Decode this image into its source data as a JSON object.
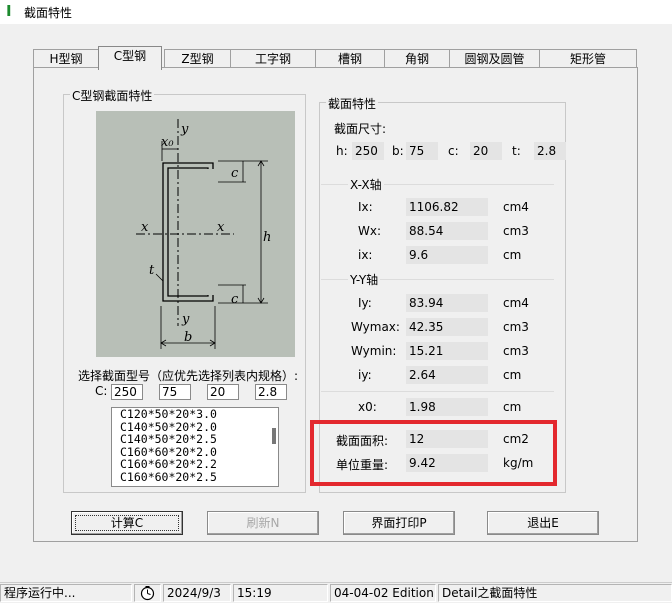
{
  "window": {
    "title": "截面特性",
    "icon": "app-icon-green-I"
  },
  "tabs": [
    {
      "label": "H型钢",
      "active": false
    },
    {
      "label": "C型钢",
      "active": true
    },
    {
      "label": "Z型钢",
      "active": false
    },
    {
      "label": "工字钢",
      "active": false
    },
    {
      "label": "槽钢",
      "active": false
    },
    {
      "label": "角钢",
      "active": false
    },
    {
      "label": "圆钢及圆管",
      "active": false
    },
    {
      "label": "矩形管",
      "active": false
    }
  ],
  "left_group": {
    "title": "C型钢截面特性",
    "diagram_labels": {
      "x0": "x₀",
      "y": "y",
      "x": "x",
      "c": "c",
      "h": "h",
      "t": "t",
      "b": "b"
    },
    "select_prompt": "选择截面型号（应优先选择列表内规格）:",
    "c_label": "C:",
    "inputs": [
      "250",
      "75",
      "20",
      "2.8"
    ],
    "list": [
      "C120*50*20*3.0",
      "C140*50*20*2.0",
      "C140*50*20*2.5",
      "C160*60*20*2.0",
      "C160*60*20*2.2",
      "C160*60*20*2.5"
    ]
  },
  "right_group": {
    "title": "截面特性",
    "size_label": "截面尺寸:",
    "dims": [
      {
        "label": "h:",
        "value": "250"
      },
      {
        "label": "b:",
        "value": "75"
      },
      {
        "label": "c:",
        "value": "20"
      },
      {
        "label": "t:",
        "value": "2.8"
      }
    ],
    "xx_title": "X-X轴",
    "xx": [
      {
        "label": "Ix:",
        "value": "1106.82",
        "unit": "cm4"
      },
      {
        "label": "Wx:",
        "value": "88.54",
        "unit": "cm3"
      },
      {
        "label": "ix:",
        "value": "9.6",
        "unit": "cm"
      }
    ],
    "yy_title": "Y-Y轴",
    "yy": [
      {
        "label": "Iy:",
        "value": "83.94",
        "unit": "cm4"
      },
      {
        "label": "Wymax:",
        "value": "42.35",
        "unit": "cm3"
      },
      {
        "label": "Wymin:",
        "value": "15.21",
        "unit": "cm3"
      },
      {
        "label": "iy:",
        "value": "2.64",
        "unit": "cm"
      }
    ],
    "x0": {
      "label": "x0:",
      "value": "1.98",
      "unit": "cm"
    },
    "area": {
      "label": "截面面积:",
      "value": "12",
      "unit": "cm2"
    },
    "weight": {
      "label": "单位重量:",
      "value": "9.42",
      "unit": "kg/m"
    },
    "highlight_color": "#e3282e"
  },
  "buttons": {
    "calc": "计算C",
    "refresh": "刷新N",
    "print": "界面打印P",
    "exit": "退出E"
  },
  "status": {
    "running": "程序运行中...",
    "clock_icon": "clock-icon",
    "date": "2024/9/3",
    "time": "15:19",
    "edition": "04-04-02 Edition",
    "detail": "Detail之截面特性"
  }
}
